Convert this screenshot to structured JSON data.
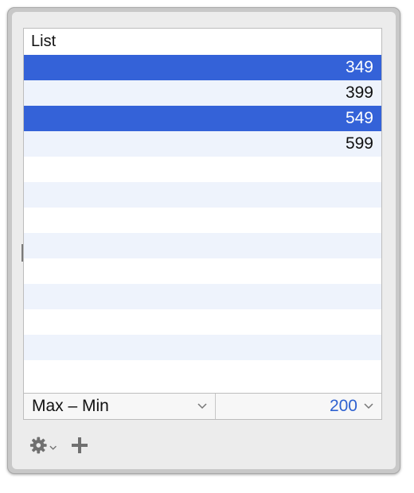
{
  "list": {
    "header": "List",
    "rows": [
      {
        "value": "349",
        "selected": true
      },
      {
        "value": "399",
        "selected": false
      },
      {
        "value": "549",
        "selected": true
      },
      {
        "value": "599",
        "selected": false
      }
    ],
    "empty_rows": 9
  },
  "footer": {
    "mode_value": "Max – Min",
    "amount_value": "200"
  },
  "toolbar": {
    "gear_icon": "gear-icon",
    "add_icon": "plus-icon"
  },
  "colors": {
    "selection": "#3462d8",
    "alt_row": "#eef3fc",
    "accent_text": "#2f62d0"
  }
}
